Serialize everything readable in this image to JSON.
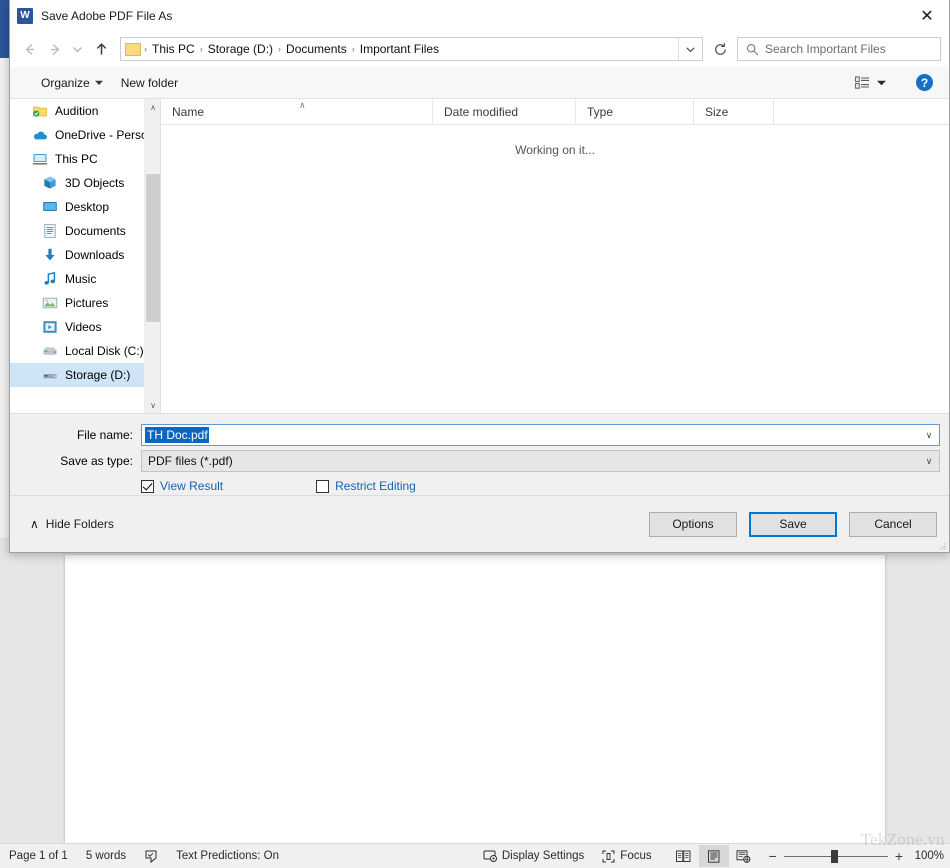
{
  "word": {
    "status_bar": {
      "page_info": "Page 1 of 1",
      "word_count": "5 words",
      "proofing_icon": "proofing-errors-icon",
      "text_predictions": "Text Predictions: On",
      "display_settings": "Display Settings",
      "focus": "Focus",
      "view_modes": [
        {
          "name": "read-mode",
          "active": false
        },
        {
          "name": "print-layout",
          "active": true
        },
        {
          "name": "web-layout",
          "active": false
        }
      ],
      "zoom_out": "−",
      "zoom_in": "+",
      "zoom_percent": "100%",
      "zoom_value": 100
    },
    "watermark": "TekZone.vn"
  },
  "dialog": {
    "title": "Save Adobe PDF File As",
    "app_icon": "W",
    "close_label": "✕",
    "nav": {
      "back_icon": "←",
      "forward_icon": "→",
      "recent_icon": "∨",
      "up_icon": "↑",
      "refresh_icon": "↻",
      "dropdown_icon": "∨"
    },
    "breadcrumb": {
      "folder_icon": "folder-icon",
      "separator": "›",
      "items": [
        "This PC",
        "Storage (D:)",
        "Documents",
        "Important Files"
      ]
    },
    "search": {
      "icon": "search-icon",
      "placeholder": "Search Important Files",
      "value": ""
    },
    "toolbar": {
      "organize": "Organize",
      "organize_caret": "▼",
      "new_folder": "New folder",
      "view_layout_icon": "view-layout-icon",
      "view_caret": "▼",
      "help": "?"
    },
    "nav_pane": {
      "items": [
        {
          "label": "Audition",
          "icon": "audition-folder-icon",
          "indent": false,
          "selected": false
        },
        {
          "label": "OneDrive - Person",
          "icon": "onedrive-icon",
          "indent": false,
          "selected": false
        },
        {
          "label": "This PC",
          "icon": "this-pc-icon",
          "indent": false,
          "selected": false
        },
        {
          "label": "3D Objects",
          "icon": "3d-objects-icon",
          "indent": true,
          "selected": false
        },
        {
          "label": "Desktop",
          "icon": "desktop-icon",
          "indent": true,
          "selected": false
        },
        {
          "label": "Documents",
          "icon": "documents-icon",
          "indent": true,
          "selected": false
        },
        {
          "label": "Downloads",
          "icon": "downloads-icon",
          "indent": true,
          "selected": false
        },
        {
          "label": "Music",
          "icon": "music-icon",
          "indent": true,
          "selected": false
        },
        {
          "label": "Pictures",
          "icon": "pictures-icon",
          "indent": true,
          "selected": false
        },
        {
          "label": "Videos",
          "icon": "videos-icon",
          "indent": true,
          "selected": false
        },
        {
          "label": "Local Disk (C:)",
          "icon": "drive-icon",
          "indent": true,
          "selected": false
        },
        {
          "label": "Storage (D:)",
          "icon": "drive-icon",
          "indent": true,
          "selected": true
        }
      ],
      "scroll_up_icon": "∧",
      "scroll_down_icon": "∨"
    },
    "file_list": {
      "columns": [
        "Name",
        "Date modified",
        "Type",
        "Size"
      ],
      "sort_indicator": "∧",
      "empty_message": "Working on it...",
      "rows": []
    },
    "form": {
      "filename_label": "File name:",
      "filename_value": "TH Doc.pdf",
      "savetype_label": "Save as type:",
      "savetype_value": "PDF files (*.pdf)",
      "combo_arrow": "∨",
      "view_result": {
        "label": "View Result",
        "checked": true
      },
      "restrict_editing": {
        "label": "Restrict Editing",
        "checked": false
      }
    },
    "footer": {
      "hide_folders_caret": "∧",
      "hide_folders": "Hide Folders",
      "options": "Options",
      "save": "Save",
      "cancel": "Cancel"
    }
  },
  "colors": {
    "word_blue": "#2b579a",
    "selection_blue": "#0a66c2",
    "focus_blue": "#0078d7",
    "link_blue": "#1763a8",
    "nav_selected": "#cfe4f7"
  }
}
